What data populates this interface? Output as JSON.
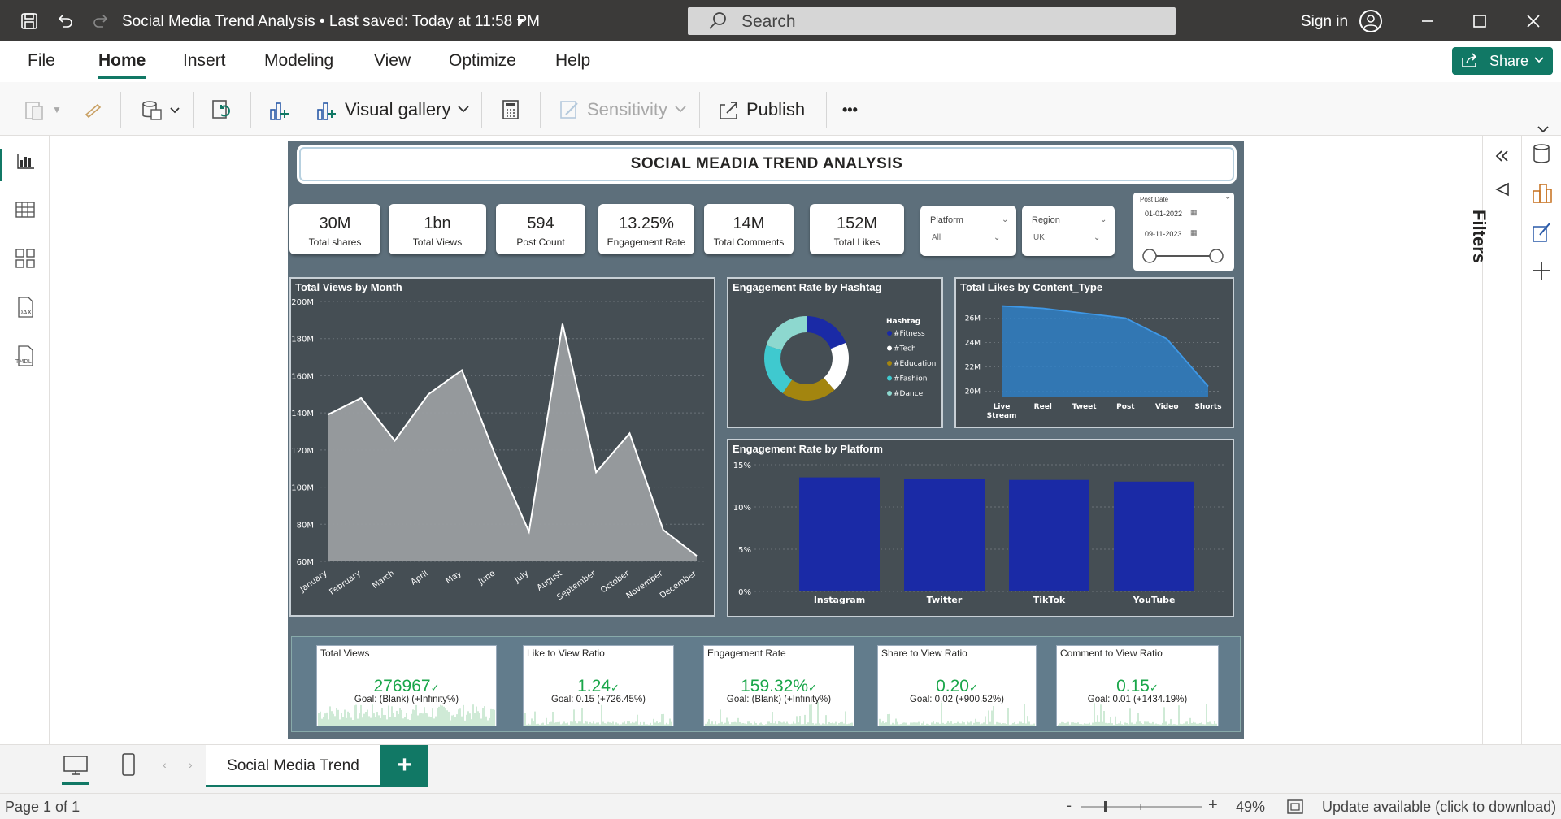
{
  "titlebar": {
    "doc_title": "Social Media Trend Analysis • Last saved: Today at 11:58 PM",
    "search_placeholder": "Search",
    "signin": "Sign in"
  },
  "menu": [
    "File",
    "Home",
    "Insert",
    "Modeling",
    "View",
    "Optimize",
    "Help"
  ],
  "share": "Share",
  "ribbon": {
    "visual_gallery": "Visual gallery",
    "sensitivity": "Sensitivity",
    "publish": "Publish",
    "more": "•••"
  },
  "report": {
    "title": "SOCIAL MEADIA TREND ANALYSIS",
    "cards": [
      {
        "value": "30M",
        "label": "Total shares"
      },
      {
        "value": "1bn",
        "label": "Total Views"
      },
      {
        "value": "594",
        "label": "Post Count"
      },
      {
        "value": "13.25%",
        "label": "Engagement Rate"
      },
      {
        "value": "14M",
        "label": "Total Comments"
      },
      {
        "value": "152M",
        "label": "Total Likes"
      }
    ],
    "slicers": {
      "platform_label": "Platform",
      "platform_value": "All",
      "region_label": "Region",
      "region_value": "UK",
      "date_label": "Post Date",
      "date_from": "01-01-2022",
      "date_to": "09-11-2023"
    },
    "kpis": [
      {
        "title": "Total Views",
        "value": "276967",
        "goal": "Goal: (Blank) (+Infinity%)"
      },
      {
        "title": "Like to View Ratio",
        "value": "1.24",
        "goal": "Goal: 0.15 (+726.45%)"
      },
      {
        "title": "Engagement Rate",
        "value": "159.32%",
        "goal": "Goal: (Blank) (+Infinity%)"
      },
      {
        "title": "Share to View Ratio",
        "value": "0.20",
        "goal": "Goal: 0.02 (+900.52%)"
      },
      {
        "title": "Comment to View Ratio",
        "value": "0.15",
        "goal": "Goal: 0.01 (+1434.19%)"
      }
    ]
  },
  "filters_label": "Filters",
  "page_tab": "Social Media Trend",
  "status": {
    "page": "Page 1 of 1",
    "zoom": "49%",
    "update": "Update available (click to download)"
  },
  "chart_data": [
    {
      "type": "area",
      "title": "Total Views by Month",
      "categories": [
        "January",
        "February",
        "March",
        "April",
        "May",
        "June",
        "July",
        "August",
        "September",
        "October",
        "November",
        "December"
      ],
      "values": [
        139000000,
        148000000,
        125000000,
        150000000,
        163000000,
        117000000,
        76000000,
        188000000,
        108000000,
        129000000,
        77000000,
        63000000
      ],
      "ylim": [
        60000000,
        200000000
      ],
      "yticks": [
        "60M",
        "80M",
        "100M",
        "120M",
        "140M",
        "160M",
        "180M",
        "200M"
      ],
      "color": "#9a9da0"
    },
    {
      "type": "pie",
      "title": "Engagement Rate by Hashtag",
      "legend_title": "Hashtag",
      "labels": [
        "#Fitness",
        "#Tech",
        "#Education",
        "#Fashion",
        "#Dance"
      ],
      "values": [
        19,
        19.5,
        21,
        20.5,
        20
      ],
      "colors": [
        "#1a2aa6",
        "#ffffff",
        "#a3850f",
        "#3fc9cf",
        "#8dd8cf"
      ]
    },
    {
      "type": "area",
      "title": "Total Likes by Content_Type",
      "categories": [
        "Live Stream",
        "Reel",
        "Tweet",
        "Post",
        "Video",
        "Shorts"
      ],
      "values": [
        27000000,
        26800000,
        26400000,
        26000000,
        24300000,
        20400000
      ],
      "ylim": [
        19500000,
        27500000
      ],
      "yticks": [
        "20M",
        "22M",
        "24M",
        "26M"
      ],
      "color": "#2f7fc4"
    },
    {
      "type": "bar",
      "title": "Engagement Rate by Platform",
      "categories": [
        "Instagram",
        "Twitter",
        "TikTok",
        "YouTube"
      ],
      "values": [
        13.5,
        13.3,
        13.2,
        13.0
      ],
      "ylim": [
        0,
        15
      ],
      "yticks": [
        "0%",
        "5%",
        "10%",
        "15%"
      ],
      "color": "#1a2aa6"
    }
  ]
}
